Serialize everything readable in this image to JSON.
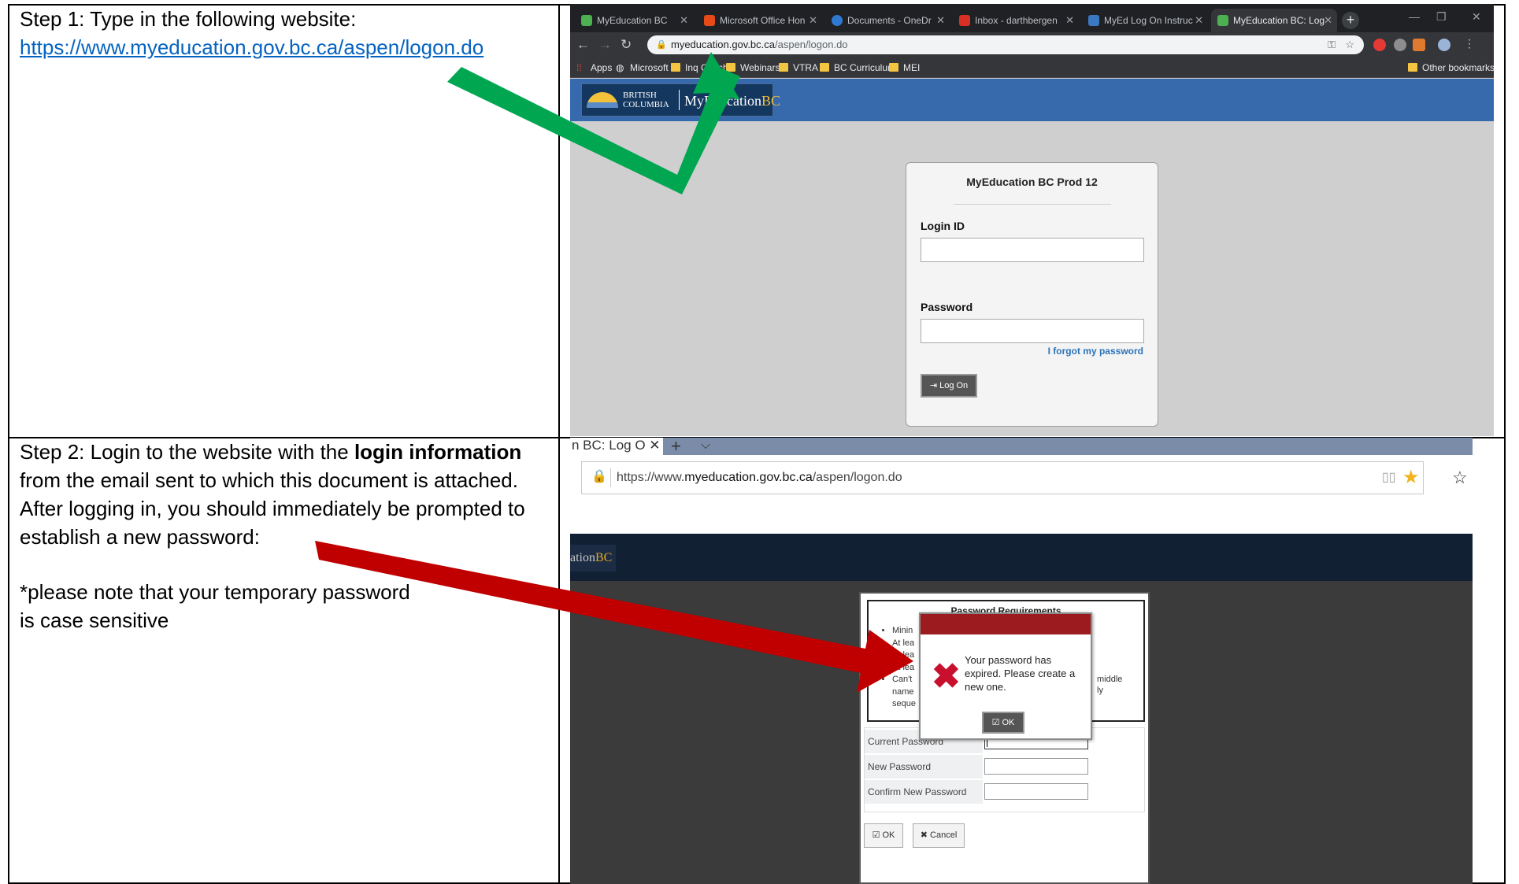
{
  "step1": {
    "text": "Step 1: Type in the following website:",
    "link": "https://www.myeducation.gov.bc.ca/aspen/logon.do"
  },
  "step2": {
    "text_a": "Step 2: Login to the website with the ",
    "text_bold": "login information",
    "text_b": " from the email sent to which this document is attached. After logging in, you should immediately be prompted to establish a new password:",
    "note_line1": "*please note that your temporary password",
    "note_line2": "is case sensitive"
  },
  "browser": {
    "tabs": [
      {
        "label": "MyEducation BC",
        "color": "#4caf50"
      },
      {
        "label": "Microsoft Office Hon",
        "color": "#e64a19"
      },
      {
        "label": "Documents - OneDr",
        "color": "#2e7ad1"
      },
      {
        "label": "Inbox - darthbergen",
        "color": "#d93025"
      },
      {
        "label": "MyEd Log On Instruc",
        "color": "#3b78c2"
      },
      {
        "label": "MyEducation BC: Log",
        "color": "#4caf50"
      }
    ],
    "url_host": "myeducation.gov.bc.ca",
    "url_path": "/aspen/logon.do",
    "bookmarks": [
      "Apps",
      "Microsoft",
      "Inq Coach",
      "Webinars",
      "VTRA",
      "BC Curriculum",
      "MEI"
    ],
    "other_bookmarks": "Other bookmarks",
    "logo_line1": "BRITISH",
    "logo_line2": "COLUMBIA",
    "logo_my": "My",
    "logo_education": "Education",
    "logo_bc": "BC"
  },
  "login": {
    "title": "MyEducation BC Prod 12",
    "login_id_label": "Login ID",
    "password_label": "Password",
    "forgot": "I forgot my password",
    "logon_button": "Log On"
  },
  "browser2": {
    "tab_label": "n BC: Log O",
    "url_scheme": "https://www.",
    "url_host": "myeducation.gov.bc.ca",
    "url_path": "/aspen/logon.do",
    "header_frag_a": "ation",
    "header_frag_b": "BC"
  },
  "password_form": {
    "req_title": "Password Requirements",
    "req_items": [
      "Minin",
      "At lea",
      "At lea",
      "At lea",
      "Can't",
      "name",
      "seque"
    ],
    "req_frag_middle": "middle",
    "req_frag_ly": "ly",
    "current_label": "Current Password",
    "new_label": "New Password",
    "confirm_label": "Confirm New Password",
    "ok_button": "OK",
    "cancel_button": "Cancel"
  },
  "alert": {
    "message": "Your password has expired. Please create a new one.",
    "ok_button": "OK"
  },
  "colors": {
    "green_arrow": "#00a650",
    "red_arrow": "#c00000",
    "link": "#0563c1"
  }
}
